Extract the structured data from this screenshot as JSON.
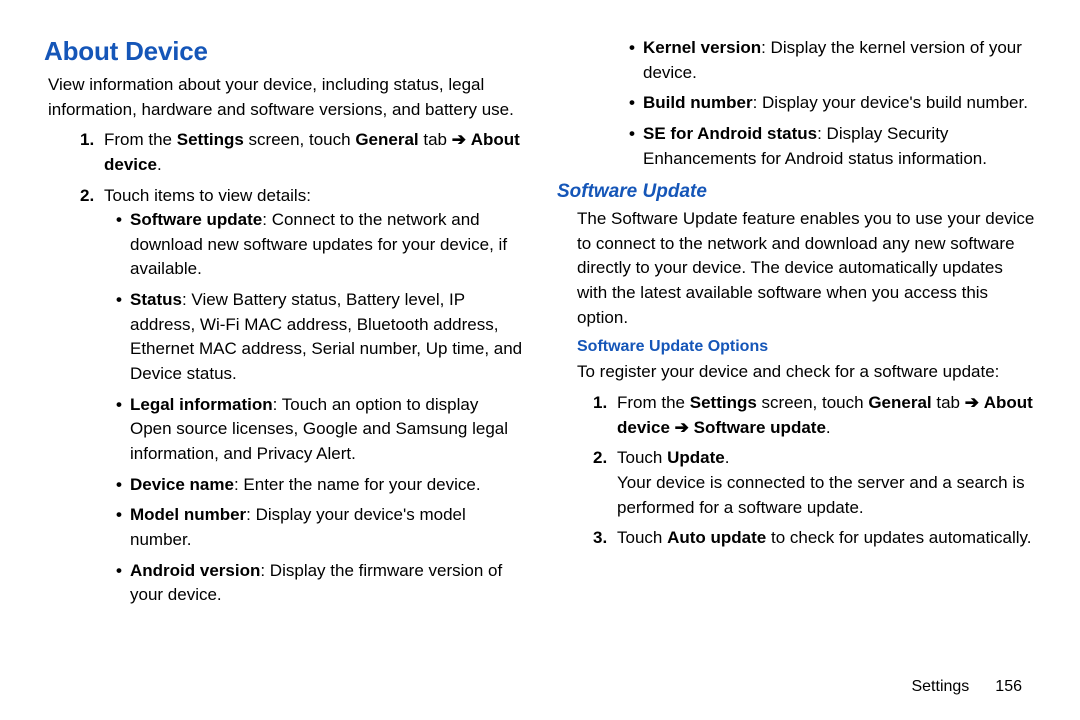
{
  "about": {
    "title": "About Device",
    "intro": "View information about your device, including status, legal information, hardware and software versions, and battery use.",
    "step1_pre": "From the ",
    "step1_settings": "Settings",
    "step1_mid": " screen, touch ",
    "step1_general": "General",
    "step1_tab": " tab ",
    "arrow": "➔",
    "step1_about": "About device",
    "step1_period": ".",
    "step2": "Touch items to view details:",
    "items": {
      "sw_label": "Software update",
      "sw_text": ": Connect to the network and download new software updates for your device, if available.",
      "status_label": "Status",
      "status_text": ": View Battery status, Battery level, IP address, Wi-Fi MAC address, Bluetooth address, Ethernet MAC address, Serial number, Up time, and Device status.",
      "legal_label": "Legal information",
      "legal_text": ": Touch an option to display Open source licenses, Google and Samsung legal information, and Privacy Alert.",
      "devname_label": "Device name",
      "devname_text": ": Enter the name for your device.",
      "model_label": "Model number",
      "model_text": ": Display your device's model number.",
      "android_label": "Android version",
      "android_text": ": Display the firmware version of your device.",
      "kernel_label": "Kernel version",
      "kernel_text": ": Display the kernel version of your device.",
      "build_label": "Build number",
      "build_text": ": Display your device's build number.",
      "se_label": "SE for Android status",
      "se_text": ": Display Security Enhancements for Android status information."
    }
  },
  "softup": {
    "title": "Software Update",
    "intro": "The Software Update feature enables you to use your device to connect to the network and download any new software directly to your device. The device automatically updates with the latest available software when you access this option.",
    "options_title": "Software Update Options",
    "register": "To register your device and check for a software update:",
    "s1_pre": "From the ",
    "s1_settings": "Settings",
    "s1_mid": " screen, touch ",
    "s1_general": "General",
    "s1_tab": " tab ",
    "s1_about": "About device",
    "s1_swu": "Software update",
    "s1_period": ".",
    "s2_pre": "Touch ",
    "s2_update": "Update",
    "s2_period": ".",
    "s2_body": "Your device is connected to the server and a search is performed for a software update.",
    "s3_pre": "Touch ",
    "s3_auto": "Auto update",
    "s3_post": " to check for updates automatically."
  },
  "footer": {
    "section": "Settings",
    "page": "156"
  }
}
